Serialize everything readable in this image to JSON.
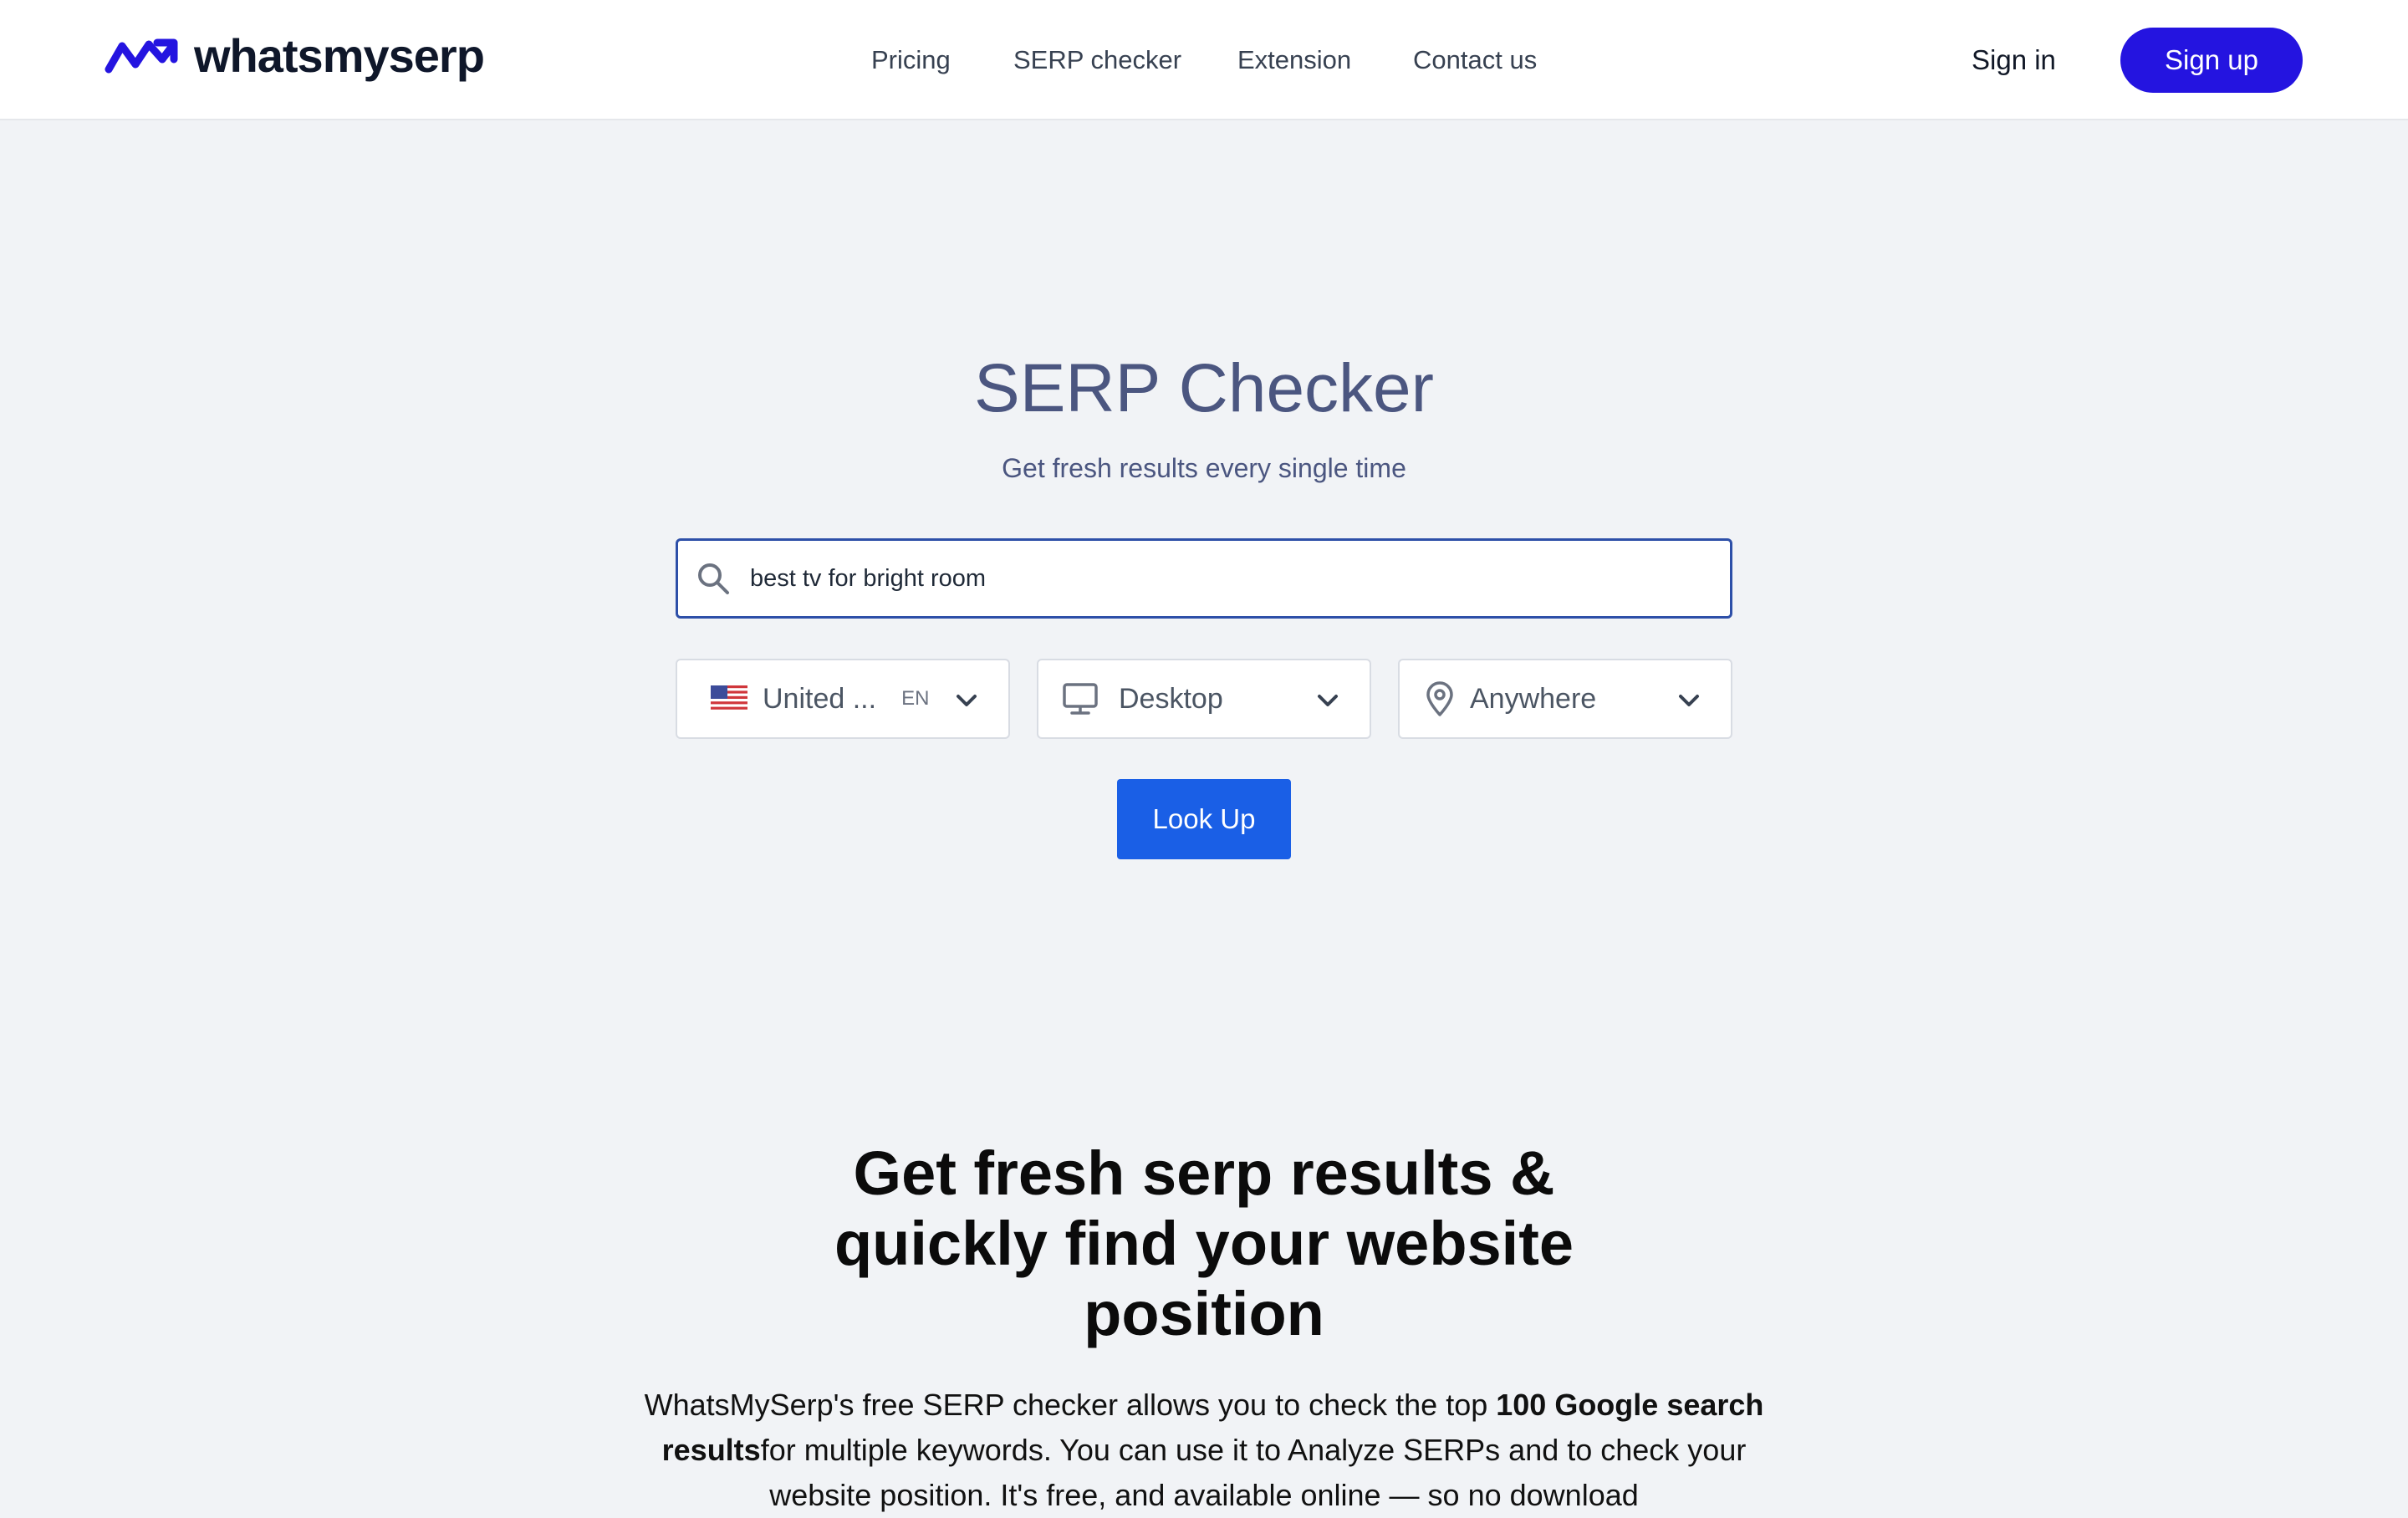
{
  "brand": {
    "name": "whatsmyserp",
    "logo_icon": "trend-arrow-icon",
    "color": "#2414e0"
  },
  "nav": {
    "items": [
      {
        "label": "Pricing"
      },
      {
        "label": "SERP checker"
      },
      {
        "label": "Extension"
      },
      {
        "label": "Contact us"
      }
    ],
    "sign_in": "Sign in",
    "sign_up": "Sign up"
  },
  "hero": {
    "title": "SERP Checker",
    "subtitle": "Get fresh results every single time",
    "search": {
      "value": "best tv for bright room",
      "icon": "search-icon"
    },
    "selects": {
      "country": {
        "label": "United ...",
        "lang": "EN",
        "icon": "us-flag-icon"
      },
      "device": {
        "label": "Desktop",
        "icon": "monitor-icon"
      },
      "location": {
        "label": "Anywhere",
        "icon": "map-pin-icon"
      }
    },
    "button": "Look Up",
    "button_color": "#1a5fe6"
  },
  "section": {
    "title": "Get fresh serp results & quickly find your website position",
    "body_1": "WhatsMySerp's free SERP checker allows you to check the top ",
    "body_bold": "100 Google search results",
    "body_2": "for multiple keywords. You can use it to Analyze SERPs and to check your website position. It's free, and available online — so no download"
  }
}
